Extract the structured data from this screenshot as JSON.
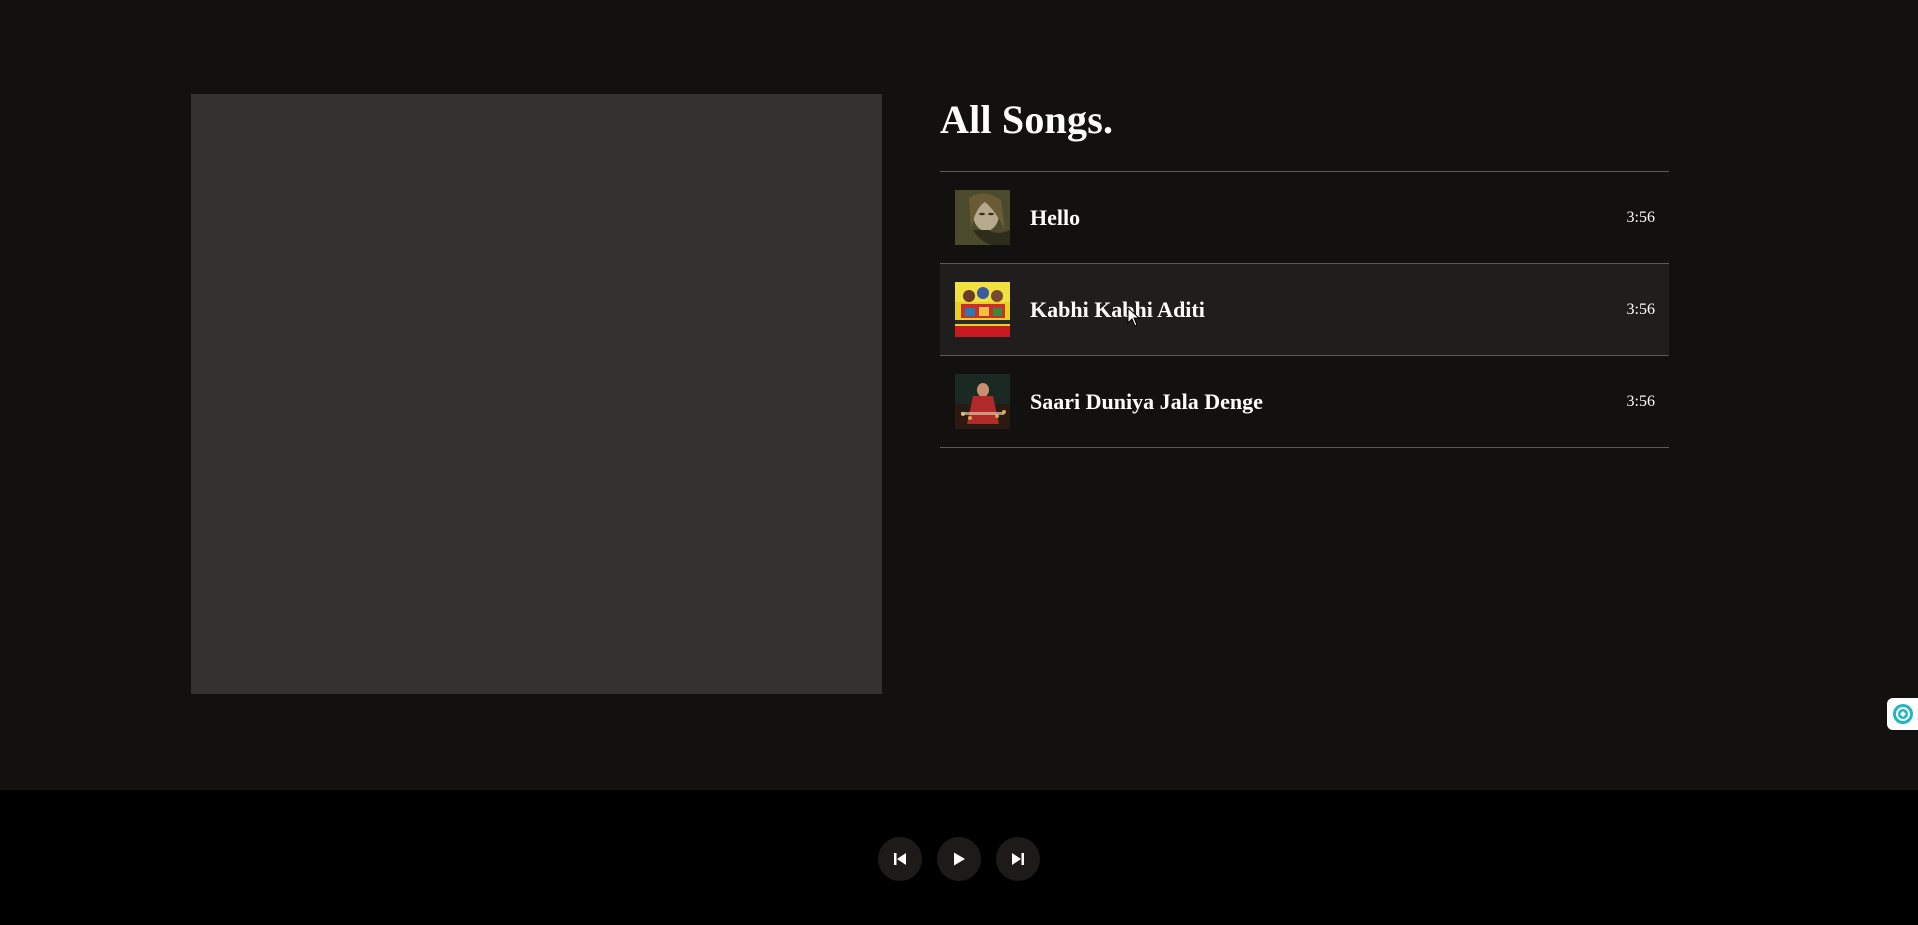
{
  "library": {
    "title": "All Songs.",
    "songs": [
      {
        "name": "Hello",
        "duration": "3:56",
        "thumb_icon": "album-art-hello"
      },
      {
        "name": "Kabhi Kabhi Aditi",
        "duration": "3:56",
        "thumb_icon": "album-art-kabhi-kabhi-aditi"
      },
      {
        "name": "Saari Duniya Jala Denge",
        "duration": "3:56",
        "thumb_icon": "album-art-saari-duniya-jala-denge"
      }
    ]
  },
  "player": {
    "controls": [
      {
        "icon": "skip-previous-icon"
      },
      {
        "icon": "play-icon"
      },
      {
        "icon": "skip-next-icon"
      }
    ]
  },
  "colors": {
    "background": "#121110",
    "cover_placeholder": "#323130",
    "player_bar": "#000000",
    "control_button": "#1c1b1a",
    "row_hover": "#1f1e1d",
    "divider": "#5c5a58",
    "widget_accent": "#1fb5c4"
  }
}
